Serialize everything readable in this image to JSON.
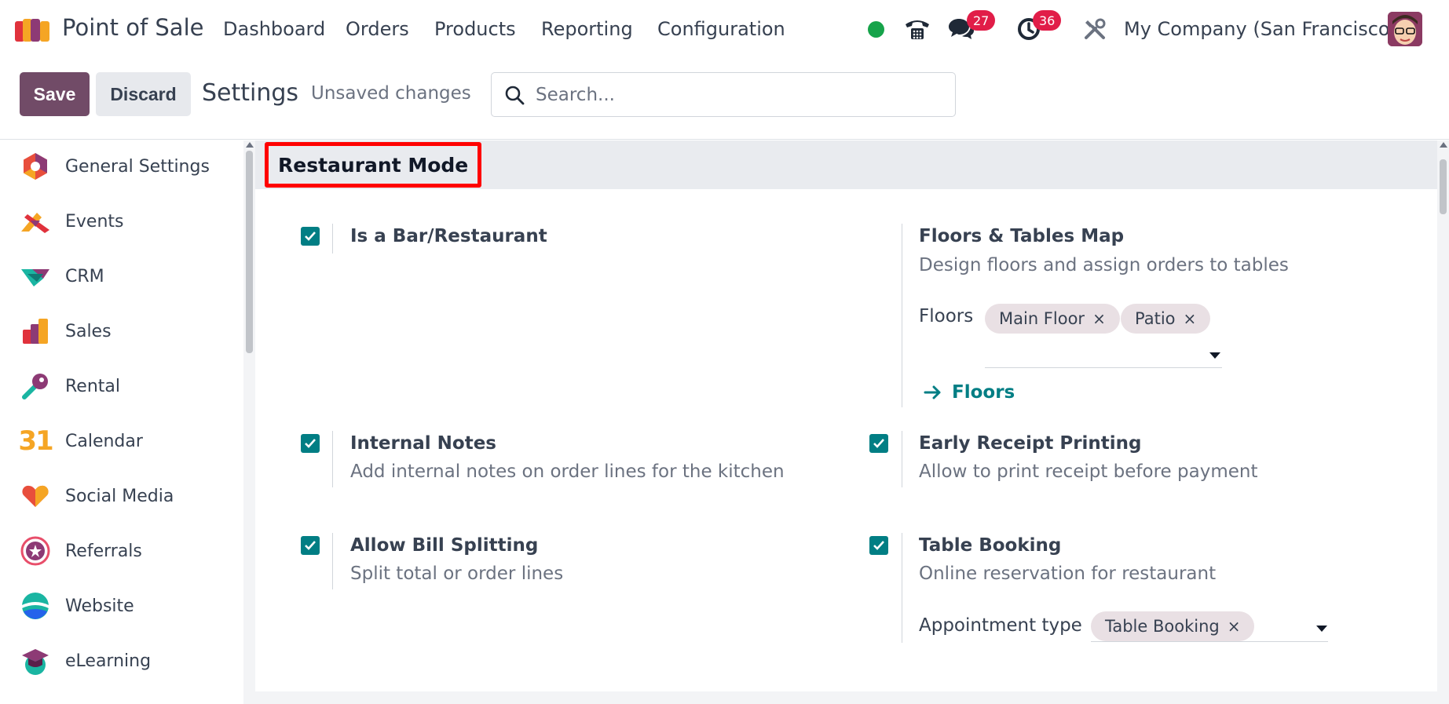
{
  "app": {
    "name": "Point of Sale",
    "logo_icon": "odoo-app-logo"
  },
  "menu": [
    "Dashboard",
    "Orders",
    "Products",
    "Reporting",
    "Configuration"
  ],
  "systray": {
    "status_color": "#16a34a",
    "messages_count": "27",
    "activities_count": "36",
    "company": "My Company (San Francisco)"
  },
  "control": {
    "save_label": "Save",
    "discard_label": "Discard",
    "title": "Settings",
    "unsaved": "Unsaved changes",
    "search_placeholder": "Search..."
  },
  "sidebar": {
    "items": [
      {
        "label": "General Settings",
        "icon": "settings-hex-icon"
      },
      {
        "label": "Events",
        "icon": "events-icon"
      },
      {
        "label": "CRM",
        "icon": "crm-icon"
      },
      {
        "label": "Sales",
        "icon": "sales-icon"
      },
      {
        "label": "Rental",
        "icon": "rental-key-icon"
      },
      {
        "label": "Calendar",
        "icon": "calendar-31-icon",
        "glyph": "31"
      },
      {
        "label": "Social Media",
        "icon": "social-media-icon"
      },
      {
        "label": "Referrals",
        "icon": "referrals-icon"
      },
      {
        "label": "Website",
        "icon": "website-icon"
      },
      {
        "label": "eLearning",
        "icon": "elearning-icon"
      }
    ]
  },
  "section": {
    "title": "Restaurant Mode",
    "settings": {
      "bar_restaurant": {
        "title": "Is a Bar/Restaurant",
        "checked": true
      },
      "floors_map": {
        "title": "Floors & Tables Map",
        "desc": "Design floors and assign orders to tables",
        "field_label": "Floors",
        "tags": [
          "Main Floor",
          "Patio"
        ],
        "link": "Floors"
      },
      "internal_notes": {
        "title": "Internal Notes",
        "desc": "Add internal notes on order lines for the kitchen",
        "checked": true
      },
      "early_receipt": {
        "title": "Early Receipt Printing",
        "desc": "Allow to print receipt before payment",
        "checked": true
      },
      "bill_splitting": {
        "title": "Allow Bill Splitting",
        "desc": "Split total or order lines",
        "checked": true
      },
      "table_booking": {
        "title": "Table Booking",
        "desc": "Online reservation for restaurant",
        "checked": true,
        "field_label": "Appointment type",
        "tags": [
          "Table Booking"
        ]
      }
    }
  },
  "colors": {
    "brand": "#714B67",
    "accent": "#017e84",
    "highlight": "#ff0000"
  }
}
